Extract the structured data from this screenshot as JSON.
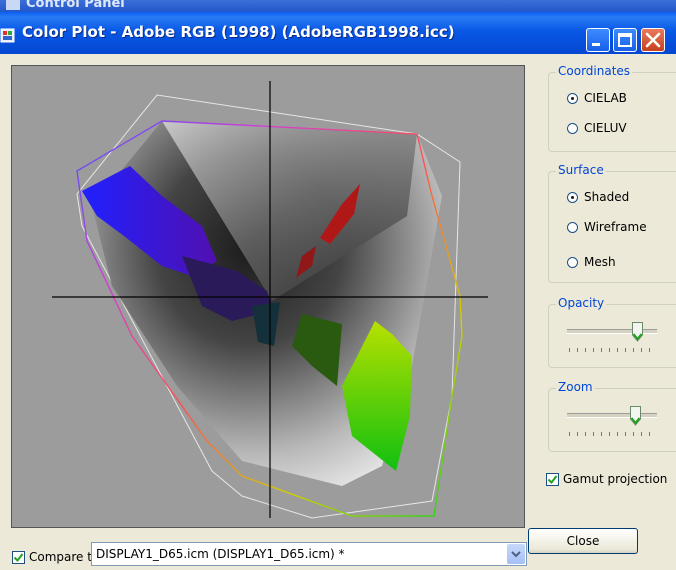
{
  "background_window": {
    "title": "Control Panel"
  },
  "window": {
    "title": "Color Plot - Adobe RGB (1998) (AdobeRGB1998.icc)"
  },
  "coordinates": {
    "group_label": "Coordinates",
    "options": [
      "CIELAB",
      "CIELUV"
    ],
    "selected": "CIELAB"
  },
  "surface": {
    "group_label": "Surface",
    "options": [
      "Shaded",
      "Wireframe",
      "Mesh"
    ],
    "selected": "Shaded"
  },
  "opacity": {
    "group_label": "Opacity",
    "value": 0.78
  },
  "zoom": {
    "group_label": "Zoom",
    "value": 0.76
  },
  "gamut_projection": {
    "label": "Gamut projection",
    "checked": true
  },
  "compare": {
    "label": "Compare t",
    "checked": true,
    "selected_profile": "DISPLAY1_D65.icm (DISPLAY1_D65.icm) *"
  },
  "close_button": {
    "label": "Close"
  },
  "colors": {
    "titlebar": "#0858e6",
    "group_label": "#0046d5",
    "plot_bg": "#9c9c9c"
  }
}
